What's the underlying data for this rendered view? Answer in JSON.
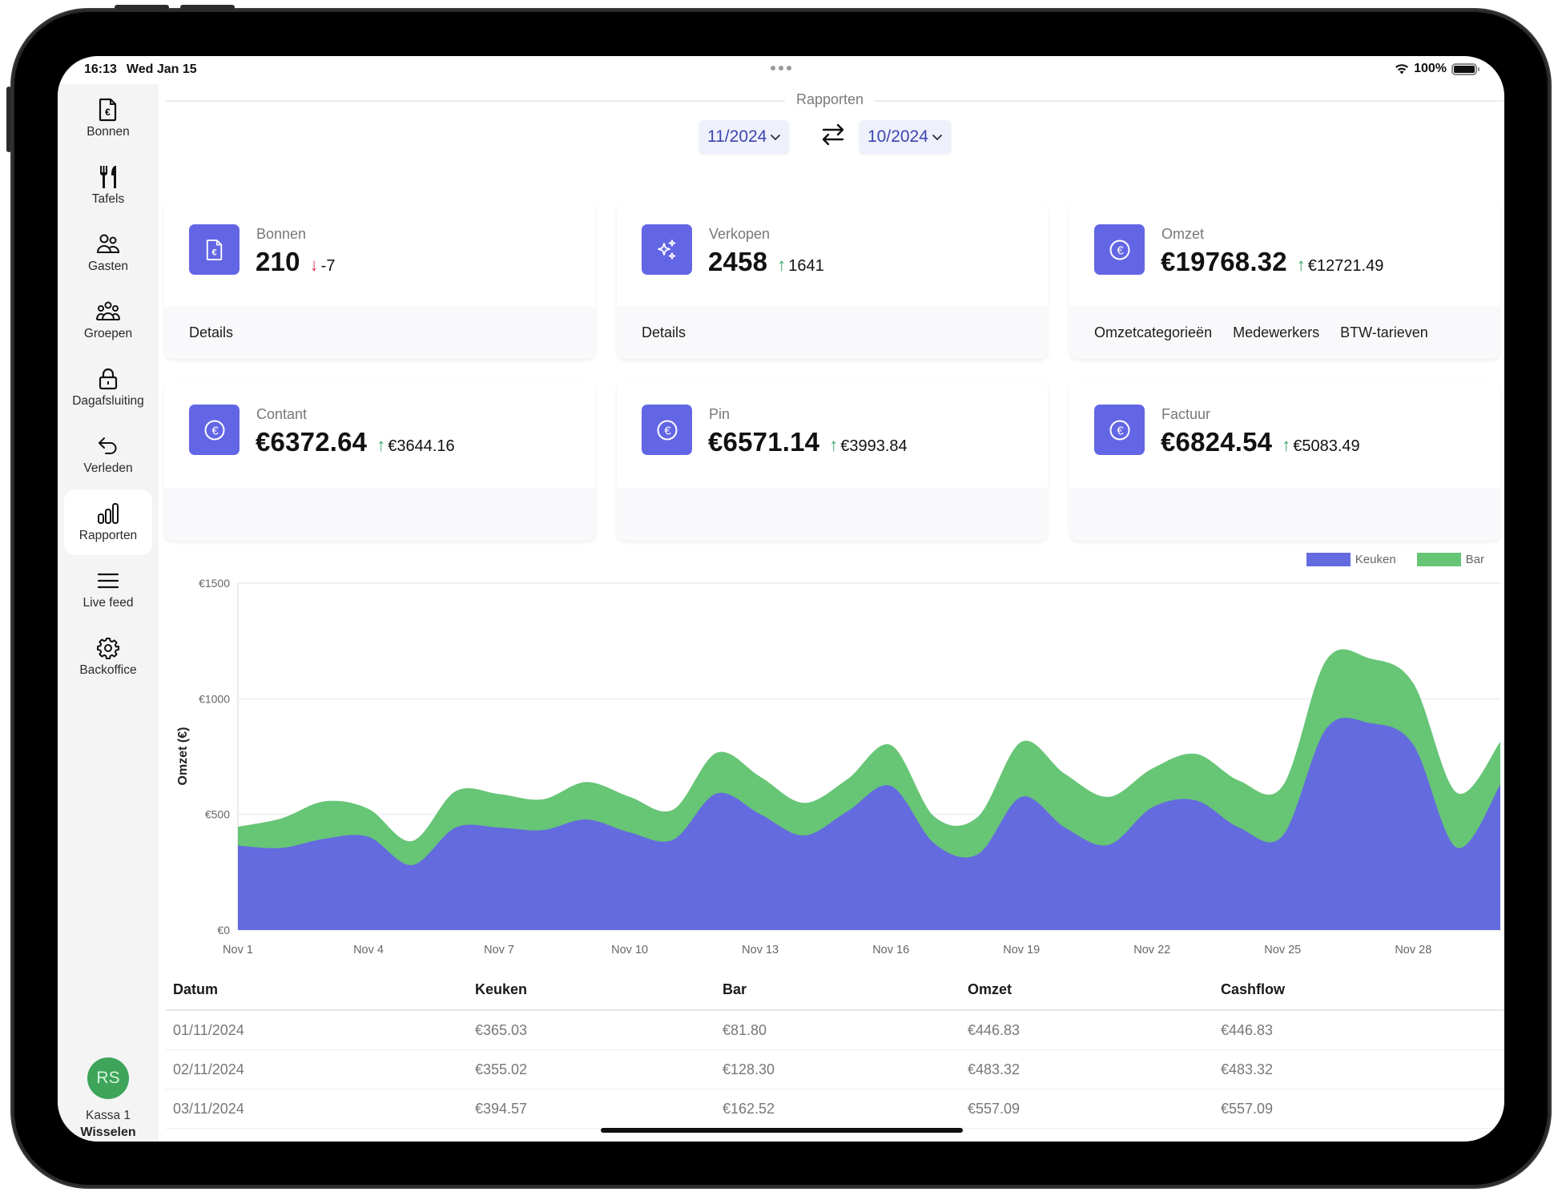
{
  "status_bar": {
    "time": "16:13",
    "date": "Wed Jan 15",
    "battery": "100%"
  },
  "sidebar": {
    "items": [
      {
        "label": "Bonnen",
        "icon": "receipt-euro-icon"
      },
      {
        "label": "Tafels",
        "icon": "fork-knife-icon"
      },
      {
        "label": "Gasten",
        "icon": "users-icon"
      },
      {
        "label": "Groepen",
        "icon": "group-icon"
      },
      {
        "label": "Dagafsluiting",
        "icon": "lock-icon"
      },
      {
        "label": "Verleden",
        "icon": "undo-arrow-icon"
      },
      {
        "label": "Rapporten",
        "icon": "bar-chart-icon",
        "active": true
      },
      {
        "label": "Live feed",
        "icon": "menu-lines-icon"
      },
      {
        "label": "Backoffice",
        "icon": "gear-icon"
      }
    ],
    "user": {
      "initials": "RS",
      "register": "Kassa 1",
      "switch_label": "Wisselen",
      "avatar_color": "#3da45a"
    }
  },
  "header": {
    "title": "Rapporten",
    "period_primary": "11/2024",
    "period_compare": "10/2024"
  },
  "cards": [
    {
      "label": "Bonnen",
      "value": "210",
      "delta": "-7",
      "direction": "down",
      "icon": "receipt-euro-icon",
      "links": [
        "Details"
      ]
    },
    {
      "label": "Verkopen",
      "value": "2458",
      "delta": "1641",
      "direction": "up",
      "icon": "sparkles-icon",
      "links": [
        "Details"
      ]
    },
    {
      "label": "Omzet",
      "value": "€19768.32",
      "delta": "€12721.49",
      "direction": "up",
      "icon": "euro-circle-icon",
      "links": [
        "Omzetcategorieën",
        "Medewerkers",
        "BTW-tarieven"
      ]
    },
    {
      "label": "Contant",
      "value": "€6372.64",
      "delta": "€3644.16",
      "direction": "up",
      "icon": "euro-circle-icon",
      "links": []
    },
    {
      "label": "Pin",
      "value": "€6571.14",
      "delta": "€3993.84",
      "direction": "up",
      "icon": "euro-circle-icon",
      "links": []
    },
    {
      "label": "Factuur",
      "value": "€6824.54",
      "delta": "€5083.49",
      "direction": "up",
      "icon": "euro-circle-icon",
      "links": []
    }
  ],
  "colors": {
    "accent": "#6366e4",
    "keuken": "#636bdf",
    "bar": "#67c576",
    "up": "#38a467",
    "down": "#e0344b"
  },
  "chart_data": {
    "type": "area",
    "stacked": true,
    "title": "",
    "xlabel": "",
    "ylabel": "Omzet (€)",
    "ylim": [
      0,
      1500
    ],
    "yticks": [
      0,
      500,
      1000,
      1500
    ],
    "ytick_labels": [
      "€0",
      "€500",
      "€1000",
      "€1500"
    ],
    "xtick_labels": [
      "Nov 1",
      "Nov 4",
      "Nov 7",
      "Nov 10",
      "Nov 13",
      "Nov 16",
      "Nov 19",
      "Nov 22",
      "Nov 25",
      "Nov 28"
    ],
    "xtick_days": [
      1,
      4,
      7,
      10,
      13,
      16,
      19,
      22,
      25,
      28
    ],
    "x": [
      1,
      2,
      3,
      4,
      5,
      6,
      7,
      8,
      9,
      10,
      11,
      12,
      13,
      14,
      15,
      16,
      17,
      18,
      19,
      20,
      21,
      22,
      23,
      24,
      25,
      26,
      27,
      28,
      29,
      30
    ],
    "grid": "horizontal",
    "legend_position": "top-right",
    "series": [
      {
        "name": "Keuken",
        "color": "#636bdf",
        "values": [
          365,
          355,
          395,
          403,
          281,
          443,
          443,
          432,
          478,
          422,
          391,
          591,
          501,
          409,
          513,
          623,
          374,
          328,
          576,
          443,
          368,
          530,
          561,
          443,
          408,
          871,
          895,
          802,
          356,
          628
        ]
      },
      {
        "name": "Bar",
        "color": "#67c576",
        "values": [
          82,
          128,
          162,
          121,
          104,
          157,
          145,
          133,
          162,
          154,
          130,
          176,
          162,
          141,
          139,
          177,
          116,
          162,
          238,
          232,
          208,
          168,
          201,
          203,
          215,
          296,
          280,
          266,
          238,
          186
        ]
      }
    ]
  },
  "table": {
    "columns": [
      "Datum",
      "Keuken",
      "Bar",
      "Omzet",
      "Cashflow"
    ],
    "rows": [
      [
        "01/11/2024",
        "€365.03",
        "€81.80",
        "€446.83",
        "€446.83"
      ],
      [
        "02/11/2024",
        "€355.02",
        "€128.30",
        "€483.32",
        "€483.32"
      ],
      [
        "03/11/2024",
        "€394.57",
        "€162.52",
        "€557.09",
        "€557.09"
      ]
    ]
  }
}
